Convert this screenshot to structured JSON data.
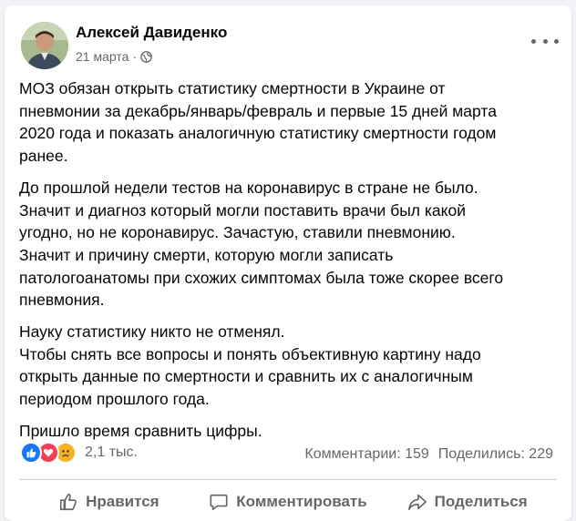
{
  "post": {
    "author": "Алексей Давиденко",
    "date": "21 марта",
    "separator": "·",
    "paragraphs": [
      "МОЗ обязан открыть статистику смертности в Украине от\nпневмонии за декабрь/январь/февраль и первые 15 дней марта\n2020 года и показать аналогичную статистику смертности годом\nранее.",
      "До прошлой недели тестов на коронавирус в стране не было.\nЗначит и диагноз который могли поставить врачи был какой\nугодно, но не коронавирус. Зачастую, ставили пневмонию.\nЗначит и причину смерти, которую могли записать\nпатологоанатомы при схожих симптомах была тоже скорее всего\nпневмония.",
      "Науку статистику никто не отменял.\nЧтобы снять все вопросы и понять объективную картину надо\nоткрыть данные по смертности и сравнить их с аналогичным\nпериодом прошлого года.",
      "Пришло время сравнить цифры."
    ]
  },
  "reactions": {
    "icons": [
      "like-icon",
      "love-icon",
      "sad-icon"
    ],
    "count": "2,1 тыс."
  },
  "stats": {
    "comments": "Комментарии: 159",
    "shares": "Поделились: 229"
  },
  "actions": {
    "like": "Нравится",
    "comment": "Комментировать",
    "share": "Поделиться"
  },
  "colors": {
    "like": "#1877f2",
    "love": "#f33e58",
    "sad": "#f7b125",
    "secondary_text": "#65676b"
  }
}
